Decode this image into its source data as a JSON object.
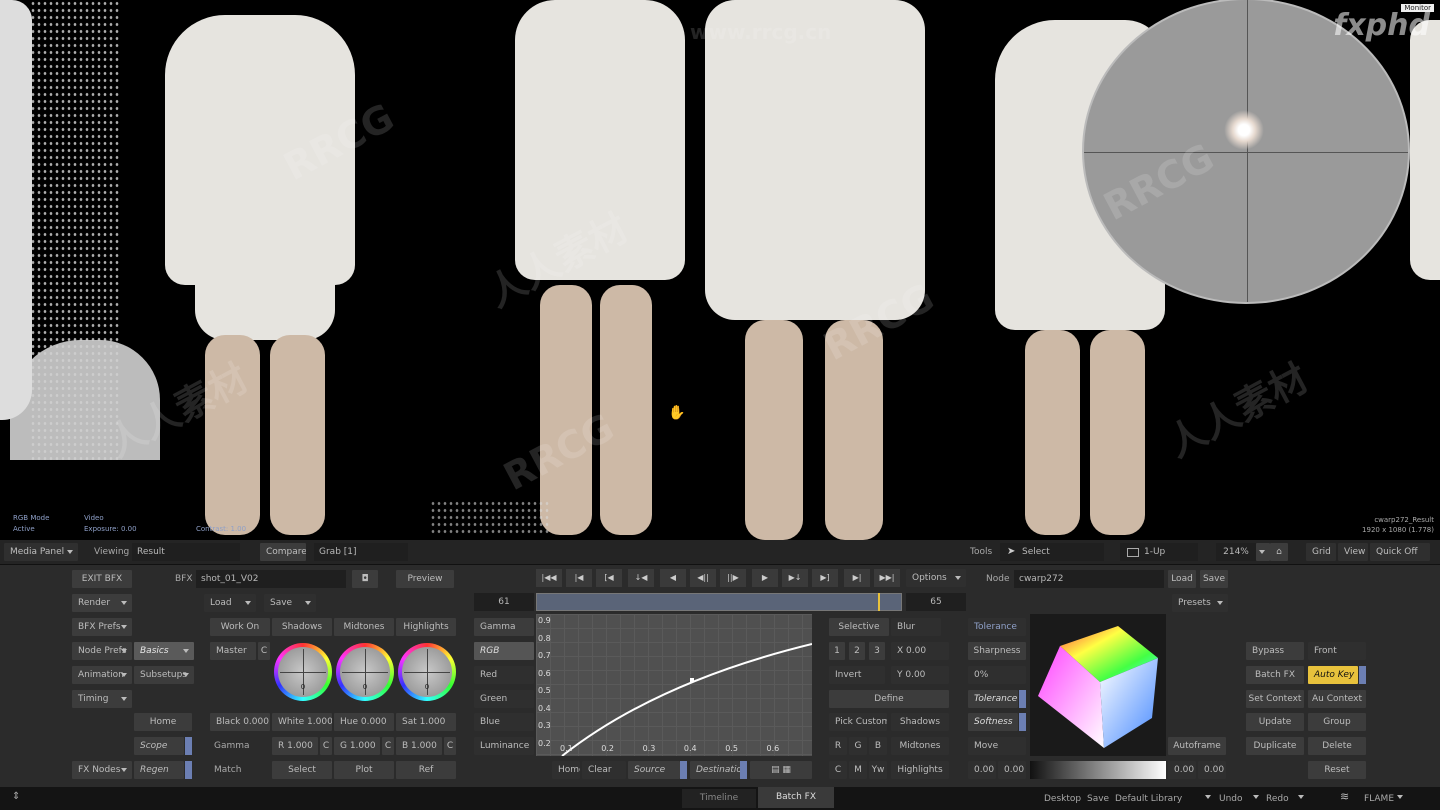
{
  "viewer": {
    "hud_left": [
      "RGB Mode",
      "Active"
    ],
    "hud_video": "Video",
    "hud_exposure": "Exposure: 0.00",
    "hud_contrast": "Contrast: 1.00",
    "node_result": "cwarp272_Result",
    "resolution": "1920 x 1080 (1.778)",
    "monitor_badge": "Monitor",
    "brand": "fxphd",
    "watermarks": [
      "RRCG",
      "人人素材",
      "www.rrcg.cn"
    ]
  },
  "topbar": {
    "media_panel": "Media Panel",
    "viewing_label": "Viewing",
    "viewing_value": "Result",
    "compare": "Compare",
    "grab": "Grab [1]",
    "tools_label": "Tools",
    "select": "Select",
    "layout": "1-Up",
    "zoom": "214%",
    "grid": "Grid",
    "view": "View",
    "quick_off": "Quick Off"
  },
  "left": {
    "exit_bfx": "EXIT BFX",
    "render": "Render",
    "bfx_prefs": "BFX Prefs",
    "node_prefs": "Node Prefs",
    "animation": "Animation",
    "timing": "Timing",
    "fx_nodes": "FX Nodes",
    "basics": "Basics",
    "subsetups": "Subsetups",
    "home": "Home",
    "scope": "Scope",
    "regen": "Regen"
  },
  "bfx": {
    "label": "BFX",
    "value": "shot_01_V02",
    "preview": "Preview",
    "load": "Load",
    "save": "Save"
  },
  "transport": {
    "options": "Options",
    "frame_start": "61",
    "frame_end": "65"
  },
  "node": {
    "label": "Node",
    "value": "cwarp272",
    "load": "Load",
    "save": "Save",
    "presets": "Presets"
  },
  "color": {
    "tabs": [
      "Work On",
      "Shadows",
      "Midtones",
      "Highlights"
    ],
    "master": "Master",
    "c": "C",
    "wheel_values": [
      "0",
      "0",
      "0"
    ],
    "black": "Black 0.000",
    "white": "White 1.000",
    "hue": "Hue 0.000",
    "sat": "Sat 1.000",
    "gamma_label": "Gamma",
    "r": "R 1.000",
    "g": "G 1.000",
    "b": "B 1.000",
    "match": "Match",
    "select": "Select",
    "plot": "Plot",
    "ref": "Ref"
  },
  "curve": {
    "channels": [
      "Gamma",
      "RGB",
      "Red",
      "Green",
      "Blue",
      "Luminance"
    ],
    "y_ticks": [
      "0.9",
      "0.8",
      "0.7",
      "0.6",
      "0.5",
      "0.4",
      "0.3",
      "0.2"
    ],
    "x_ticks": [
      "0.1",
      "0.2",
      "0.3",
      "0.4",
      "0.5",
      "0.6"
    ],
    "home": "Home",
    "clear": "Clear",
    "source": "Source",
    "destination": "Destination",
    "timeline": "Timeline",
    "batch_fx": "Batch FX"
  },
  "keyer": {
    "selective": "Selective",
    "blur": "Blur",
    "nums": [
      "1",
      "2",
      "3"
    ],
    "x": "X 0.00",
    "y": "Y 0.00",
    "invert": "Invert",
    "define": "Define",
    "pick_custom": "Pick Custom",
    "shadows": "Shadows",
    "rgb": [
      "R",
      "G",
      "B"
    ],
    "midtones": "Midtones",
    "cmy": [
      "C",
      "M",
      "Yw"
    ],
    "highlights": "Highlights",
    "tolerance_tab": "Tolerance",
    "sharpness": "Sharpness",
    "pct": "0%",
    "tolerance": "Tolerance",
    "softness": "Softness",
    "move": "Move",
    "v1": "0.00",
    "v2": "0.00",
    "autoframe": "Autoframe",
    "v3": "0.00",
    "v4": "0.00"
  },
  "right": {
    "bypass": "Bypass",
    "front": "Front",
    "batch_fx": "Batch FX",
    "auto_key": "Auto Key",
    "set_context": "Set Context",
    "au_context": "Au Context",
    "update": "Update",
    "group": "Group",
    "duplicate": "Duplicate",
    "delete": "Delete",
    "reset": "Reset"
  },
  "status": {
    "desktop": "Desktop",
    "save": "Save",
    "library": "Default Library",
    "undo": "Undo",
    "redo": "Redo",
    "app": "FLAME"
  },
  "colors": {
    "accent_blue": "#6c7fb3",
    "auto_key_yellow": "#e8c23c"
  }
}
